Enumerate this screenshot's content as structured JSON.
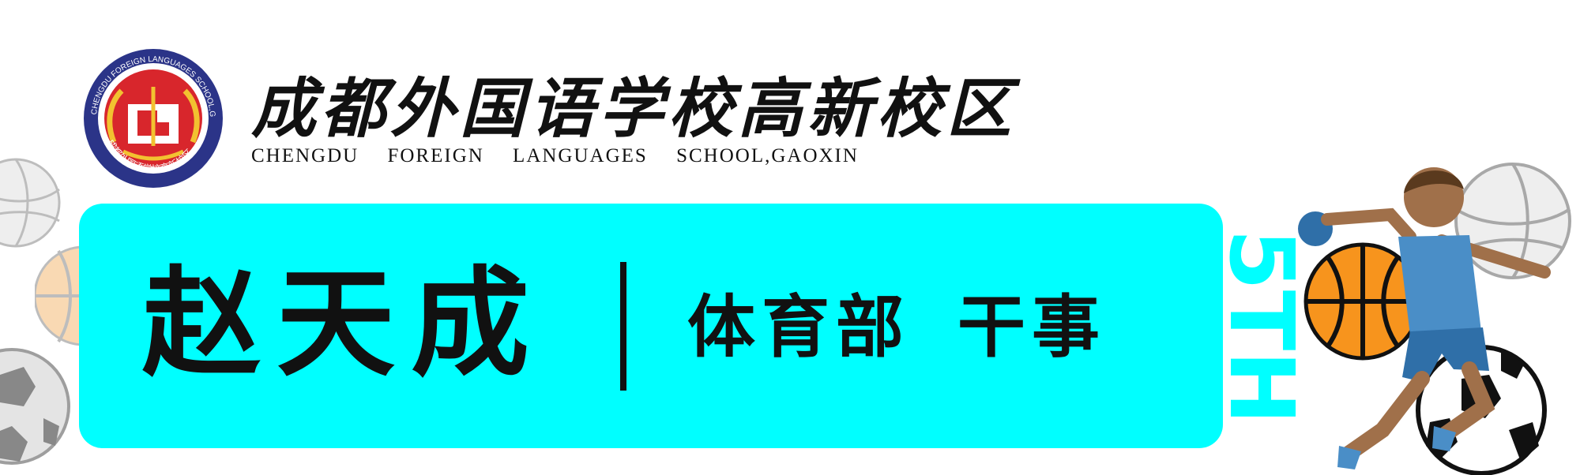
{
  "header": {
    "school_name_cn": "成都外国语学校高新校区",
    "school_name_en": "CHENGDU FOREIGN LANGUAGES SCHOOL,GAOXIN",
    "logo": {
      "ring_text": "CHENGDU FOREIGN LANGUAGES SCHOOL,GAOXIN",
      "inner_text": "成都外国语学校高新校区",
      "colors": {
        "ring": "#2b3488",
        "inner": "#d8262c",
        "laurel": "#f2c230"
      }
    }
  },
  "banner": {
    "person_name": "赵天成",
    "department": "体育部",
    "position": "干事",
    "side_text": "5TH",
    "colors": {
      "background": "#00ffff",
      "side_text": "#00ffff"
    }
  },
  "decorations": {
    "icons": [
      "volleyball-icon",
      "basketball-icon",
      "soccer-ball-icon",
      "handball-player-icon"
    ]
  }
}
